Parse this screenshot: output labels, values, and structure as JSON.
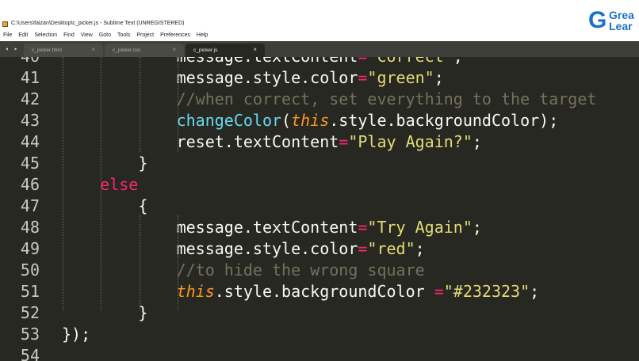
{
  "window": {
    "title": "C:\\Users\\faizan\\Desktop\\c_picker.js - Sublime Text (UNREGISTERED)",
    "brand_line1": "Grea",
    "brand_line2": "Lear",
    "brand_letter": "G"
  },
  "menu": [
    "File",
    "Edit",
    "Selection",
    "Find",
    "View",
    "Goto",
    "Tools",
    "Project",
    "Preferences",
    "Help"
  ],
  "tab_nav": "◂ ▸",
  "tabs": [
    {
      "label": "c_picker.html",
      "close": "×",
      "active": false
    },
    {
      "label": "c_picker.css",
      "close": "×",
      "active": false
    },
    {
      "label": "c_picker.js",
      "close": "×",
      "active": true
    }
  ],
  "editor": {
    "colors": {
      "background": "#272822",
      "keyword": "#f92672",
      "function": "#66d9ef",
      "string": "#e6db74",
      "comment": "#75715e",
      "this": "#fd971f"
    },
    "lines": [
      {
        "num": "40",
        "indent": 6,
        "tokens": [
          {
            "t": "message.textContent=\"Correct\";",
            "c": "partial"
          }
        ]
      },
      {
        "num": "41",
        "indent": 6,
        "tokens": [
          {
            "t": "message.style.color",
            "c": ""
          },
          {
            "t": "=",
            "c": "op"
          },
          {
            "t": "\"green\"",
            "c": "str"
          },
          {
            "t": ";",
            "c": ""
          }
        ]
      },
      {
        "num": "42",
        "indent": 6,
        "tokens": [
          {
            "t": "//when correct, set everything to the target",
            "c": "cm"
          }
        ]
      },
      {
        "num": "43",
        "indent": 6,
        "tokens": [
          {
            "t": "changeColor",
            "c": "fn"
          },
          {
            "t": "(",
            "c": ""
          },
          {
            "t": "this",
            "c": "this"
          },
          {
            "t": ".style.backgroundColor);",
            "c": ""
          }
        ]
      },
      {
        "num": "44",
        "indent": 6,
        "tokens": [
          {
            "t": "reset.textContent",
            "c": ""
          },
          {
            "t": "=",
            "c": "op"
          },
          {
            "t": "\"Play Again?\"",
            "c": "str"
          },
          {
            "t": ";",
            "c": ""
          }
        ]
      },
      {
        "num": "45",
        "indent": 4,
        "tokens": [
          {
            "t": "}",
            "c": ""
          }
        ]
      },
      {
        "num": "46",
        "indent": 2,
        "tokens": [
          {
            "t": "else",
            "c": "kw"
          }
        ]
      },
      {
        "num": "47",
        "indent": 4,
        "tokens": [
          {
            "t": "{",
            "c": ""
          }
        ]
      },
      {
        "num": "48",
        "indent": 6,
        "tokens": [
          {
            "t": "message.textContent",
            "c": ""
          },
          {
            "t": "=",
            "c": "op"
          },
          {
            "t": "\"Try Again\"",
            "c": "str"
          },
          {
            "t": ";",
            "c": ""
          }
        ]
      },
      {
        "num": "49",
        "indent": 6,
        "tokens": [
          {
            "t": "message.style.color",
            "c": ""
          },
          {
            "t": "=",
            "c": "op"
          },
          {
            "t": "\"red\"",
            "c": "str"
          },
          {
            "t": ";",
            "c": ""
          }
        ]
      },
      {
        "num": "50",
        "indent": 6,
        "tokens": [
          {
            "t": "//to hide the wrong square",
            "c": "cm"
          }
        ]
      },
      {
        "num": "51",
        "indent": 6,
        "tokens": [
          {
            "t": "this",
            "c": "this"
          },
          {
            "t": ".style.backgroundColor ",
            "c": ""
          },
          {
            "t": "=",
            "c": "op"
          },
          {
            "t": "\"#232323\"",
            "c": "str"
          },
          {
            "t": ";",
            "c": ""
          }
        ]
      },
      {
        "num": "52",
        "indent": 4,
        "tokens": [
          {
            "t": "}",
            "c": ""
          }
        ]
      },
      {
        "num": "53",
        "indent": 0,
        "tokens": [
          {
            "t": "});",
            "c": ""
          }
        ]
      },
      {
        "num": "54",
        "indent": 0,
        "tokens": []
      }
    ]
  }
}
